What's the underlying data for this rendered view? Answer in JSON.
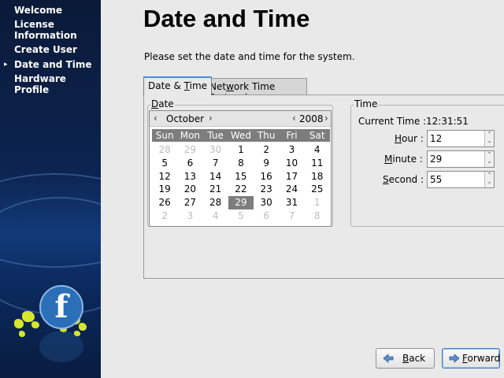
{
  "sidebar": {
    "steps": [
      "Welcome",
      "License Information",
      "Create User",
      "Date and Time",
      "Hardware Profile"
    ],
    "current_step_index": 3,
    "logo_letter": "f"
  },
  "main": {
    "title": "Date and Time",
    "intro": "Please set the date and time for the system."
  },
  "tabs": [
    {
      "label_pre": "Date & ",
      "label_accel": "T",
      "label_post": "ime"
    },
    {
      "label_pre": "Net",
      "label_accel": "w",
      "label_post": "ork Time Protocol"
    }
  ],
  "date_frame": {
    "label_accel": "D",
    "label_post": "ate",
    "calendar": {
      "month": "October",
      "year": "2008",
      "weekdays": [
        "Sun",
        "Mon",
        "Tue",
        "Wed",
        "Thu",
        "Fri",
        "Sat"
      ],
      "weeks": [
        [
          "28",
          "29",
          "30",
          "1",
          "2",
          "3",
          "4"
        ],
        [
          "5",
          "6",
          "7",
          "8",
          "9",
          "10",
          "11"
        ],
        [
          "12",
          "13",
          "14",
          "15",
          "16",
          "17",
          "18"
        ],
        [
          "19",
          "20",
          "21",
          "22",
          "23",
          "24",
          "25"
        ],
        [
          "26",
          "27",
          "28",
          "29",
          "30",
          "31",
          "1"
        ],
        [
          "2",
          "3",
          "4",
          "5",
          "6",
          "7",
          "8"
        ]
      ],
      "selected_day": "29"
    }
  },
  "time_frame": {
    "label": "Time",
    "current_time_label": "Current Time :",
    "current_time_value": "12:31:51",
    "hour": {
      "label_accel": "H",
      "label_post": "our :",
      "value": "12"
    },
    "minute": {
      "label_accel": "M",
      "label_post": "inute :",
      "value": "29"
    },
    "second": {
      "label_accel": "S",
      "label_post": "econd :",
      "value": "55"
    }
  },
  "buttons": {
    "back": {
      "label_accel": "B",
      "label_post": "ack"
    },
    "forward": {
      "label_accel": "F",
      "label_post": "orward"
    }
  },
  "colors": {
    "sidebar_top": "#0a1a38",
    "sidebar_mid": "#123a78",
    "selected_day_bg": "#7d7d7d",
    "weekday_header_bg": "#7d7d7d",
    "logo_blue": "#2a6fb8",
    "bubble_yellow": "#d6e62c"
  },
  "icons": {
    "current_step": "triangle-right-icon",
    "back": "back-arrow-icon",
    "forward": "forward-arrow-icon",
    "spin": "spin-up-down-icon"
  }
}
